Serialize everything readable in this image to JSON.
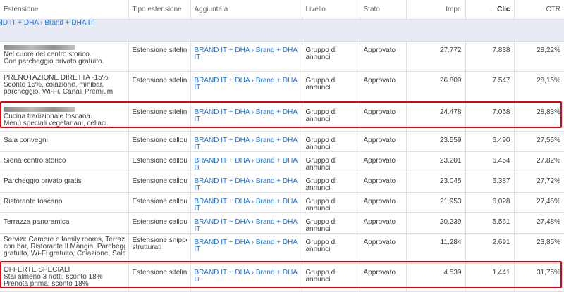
{
  "columns": {
    "estensione": "Estensione",
    "tipo": "Tipo estensione",
    "aggiunta": "Aggiunta a",
    "livello": "Livello",
    "stato": "Stato",
    "impr": "Impr.",
    "clic": "Clic",
    "ctr": "CTR",
    "sort_icon": "arrow-down-icon"
  },
  "group_label": "BRAND IT + DHA › Brand + DHA IT",
  "colors": {
    "link": "#1a73e8",
    "highlight": "#e3000f",
    "group_bg": "#e8eaf4"
  },
  "rows": [
    {
      "ext": [
        "Nel cuore del centro storico.",
        "Con parcheggio privato gratuito."
      ],
      "redacted_first_line": true,
      "tipo": [
        "Estensione sitelink"
      ],
      "aggiunta": "BRAND IT + DHA › Brand + DHA IT",
      "livello": "Gruppo di annunci",
      "stato": "Approvato",
      "impr": "27.772",
      "clic": "7.838",
      "ctr": "28,22%"
    },
    {
      "ext": [
        "PRENOTAZIONE DIRETTA -15%",
        "Sconto 15%, colazione, minibar,",
        "parcheggio, Wi-Fi, Canali Premium"
      ],
      "tipo": [
        "Estensione sitelink"
      ],
      "aggiunta": "BRAND IT + DHA › Brand + DHA IT",
      "livello": "Gruppo di annunci",
      "stato": "Approvato",
      "impr": "26.809",
      "clic": "7.547",
      "ctr": "28,15%"
    },
    {
      "ext": [
        "Cucina tradizionale toscana.",
        "Menù speciali vegetariani, celiaci."
      ],
      "redacted_first_line": true,
      "highlighted": true,
      "tipo": [
        "Estensione sitelink"
      ],
      "aggiunta": "BRAND IT + DHA › Brand + DHA IT",
      "livello": "Gruppo di annunci",
      "stato": "Approvato",
      "impr": "24.478",
      "clic": "7.058",
      "ctr": "28,83%"
    },
    {
      "ext": [
        "Sala convegni"
      ],
      "tipo": [
        "Estensione callout"
      ],
      "aggiunta": "BRAND IT + DHA › Brand + DHA IT",
      "livello": "Gruppo di annunci",
      "stato": "Approvato",
      "impr": "23.559",
      "clic": "6.490",
      "ctr": "27,55%"
    },
    {
      "ext": [
        "Siena centro storico"
      ],
      "tipo": [
        "Estensione callout"
      ],
      "aggiunta": "BRAND IT + DHA › Brand + DHA IT",
      "livello": "Gruppo di annunci",
      "stato": "Approvato",
      "impr": "23.201",
      "clic": "6.454",
      "ctr": "27,82%"
    },
    {
      "ext": [
        "Parcheggio privato gratis"
      ],
      "tipo": [
        "Estensione callout"
      ],
      "aggiunta": "BRAND IT + DHA › Brand + DHA IT",
      "livello": "Gruppo di annunci",
      "stato": "Approvato",
      "impr": "23.045",
      "clic": "6.387",
      "ctr": "27,72%"
    },
    {
      "ext": [
        "Ristorante toscano"
      ],
      "tipo": [
        "Estensione callout"
      ],
      "aggiunta": "BRAND IT + DHA › Brand + DHA IT",
      "livello": "Gruppo di annunci",
      "stato": "Approvato",
      "impr": "21.953",
      "clic": "6.028",
      "ctr": "27,46%"
    },
    {
      "ext": [
        "Terrazza panoramica"
      ],
      "tipo": [
        "Estensione callout"
      ],
      "aggiunta": "BRAND IT + DHA › Brand + DHA IT",
      "livello": "Gruppo di annunci",
      "stato": "Approvato",
      "impr": "20.239",
      "clic": "5.561",
      "ctr": "27,48%"
    },
    {
      "ext": [
        "Servizi: Camere e family rooms, Terrazza",
        "con bar, Ristorante Il Mangia, Parcheggio",
        "gratuito, Wi-Fi gratuito, Colazione, Sala..."
      ],
      "tipo": [
        "Estensione snippet",
        "strutturati"
      ],
      "aggiunta": "BRAND IT + DHA › Brand + DHA IT",
      "livello": "Gruppo di annunci",
      "stato": "Approvato",
      "impr": "11.284",
      "clic": "2.691",
      "ctr": "23,85%"
    },
    {
      "ext": [
        "OFFERTE SPECIALI",
        "Stai almeno 3 notti: sconto 18%",
        "Prenota prima: sconto 18%"
      ],
      "highlighted": true,
      "tipo": [
        "Estensione sitelink"
      ],
      "aggiunta": "BRAND IT + DHA › Brand + DHA IT",
      "livello": "Gruppo di annunci",
      "stato": "Approvato",
      "impr": "4.539",
      "clic": "1.441",
      "ctr": "31,75%"
    }
  ]
}
